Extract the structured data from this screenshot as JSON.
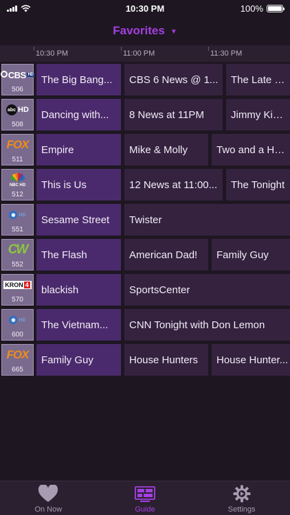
{
  "status_bar": {
    "time": "10:30 PM",
    "battery": "100%",
    "battery_level": 1.0
  },
  "header": {
    "title": "Favorites",
    "caret_icon": "caret-down-icon"
  },
  "timeline": [
    "10:30 PM",
    "11:00 PM",
    "11:30 PM"
  ],
  "colors": {
    "accent": "#a43fe0",
    "current_program": "#4a2a6c",
    "future_program": "#34223f",
    "channel_tile": "#7a6a8e",
    "background": "#1e1722"
  },
  "channels": [
    {
      "number": "506",
      "logo": "cbs-hd-logo",
      "logo_text": "CBS",
      "programs": [
        {
          "title": "The Big Bang..."
        },
        {
          "title": "CBS 6 News @ 1..."
        },
        {
          "title": "The Late Show"
        }
      ]
    },
    {
      "number": "508",
      "logo": "abc-hd-logo",
      "logo_text": "abc",
      "programs": [
        {
          "title": "Dancing with..."
        },
        {
          "title": "8 News at 11PM"
        },
        {
          "title": "Jimmy Kimmel"
        }
      ]
    },
    {
      "number": "511",
      "logo": "fox-logo",
      "logo_text": "FOX",
      "programs": [
        {
          "title": "Empire"
        },
        {
          "title": "Mike & Molly"
        },
        {
          "title": "Two and a Hal..."
        }
      ]
    },
    {
      "number": "512",
      "logo": "nbc-hd-logo",
      "logo_text": "NBC HD",
      "programs": [
        {
          "title": "This is Us"
        },
        {
          "title": "12 News at 11:00..."
        },
        {
          "title": "The Tonight"
        }
      ]
    },
    {
      "number": "551",
      "logo": "pbs-hd-logo",
      "logo_text": "",
      "programs": [
        {
          "title": "Sesame Street"
        },
        {
          "title": "Twister"
        }
      ]
    },
    {
      "number": "552",
      "logo": "cw-logo",
      "logo_text": "CW",
      "programs": [
        {
          "title": "The Flash"
        },
        {
          "title": "American Dad!"
        },
        {
          "title": "Family Guy"
        }
      ]
    },
    {
      "number": "570",
      "logo": "kron4-logo",
      "logo_text": "KRON",
      "programs": [
        {
          "title": "blackish"
        },
        {
          "title": "SportsCenter"
        }
      ]
    },
    {
      "number": "600",
      "logo": "pbs-hd-logo",
      "logo_text": "",
      "programs": [
        {
          "title": "The Vietnam..."
        },
        {
          "title": "CNN Tonight with Don Lemon"
        }
      ]
    },
    {
      "number": "665",
      "logo": "fox-logo",
      "logo_text": "FOX",
      "programs": [
        {
          "title": "Family Guy"
        },
        {
          "title": "House Hunters"
        },
        {
          "title": "House Hunter..."
        }
      ]
    }
  ],
  "tabbar": {
    "tabs": [
      {
        "label": "On Now",
        "icon": "heart-icon",
        "active": false
      },
      {
        "label": "Guide",
        "icon": "grid-icon",
        "active": true
      },
      {
        "label": "Settings",
        "icon": "gear-icon",
        "active": false
      }
    ]
  }
}
